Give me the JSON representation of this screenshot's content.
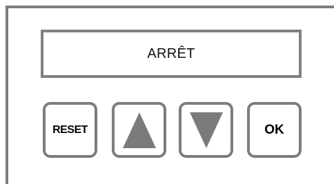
{
  "display": {
    "status_text": "ARRÊT"
  },
  "buttons": {
    "reset_label": "RESET",
    "ok_label": "OK",
    "up_icon": "triangle-up-icon",
    "down_icon": "triangle-down-icon"
  },
  "colors": {
    "frame": "#7d7d7d",
    "arrow_fill": "#7b7b7b",
    "text": "#111111"
  }
}
